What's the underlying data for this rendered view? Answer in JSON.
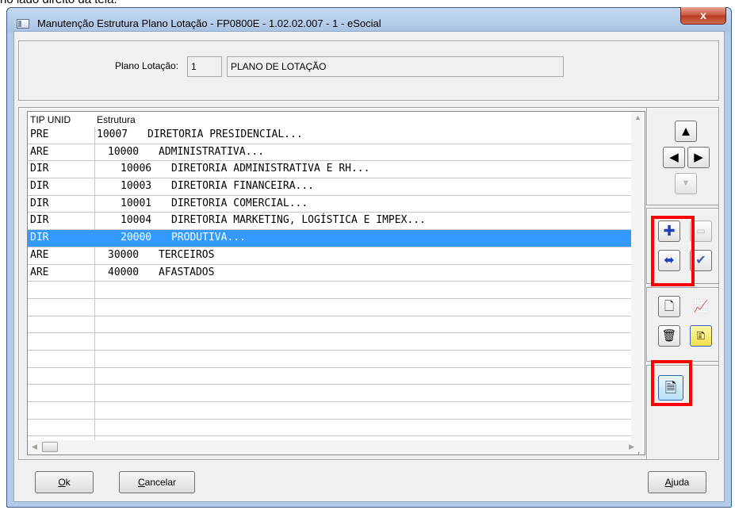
{
  "caption": "no lado direito da tela.",
  "window": {
    "title": "Manutenção Estrutura Plano Lotação - FP0800E - 1.02.02.007 - 1 - eSocial",
    "close_label": "x"
  },
  "plano": {
    "label": "Plano Lotação:",
    "code": "1",
    "name": "PLANO DE LOTAÇÃO"
  },
  "grid": {
    "columns": [
      "TIP UNID",
      "Estrutura"
    ],
    "rows": [
      {
        "tip": "PRE",
        "code": "10007",
        "desc": "DIRETORIA PRESIDENCIAL...",
        "level": 0,
        "selected": false
      },
      {
        "tip": "ARE",
        "code": "10000",
        "desc": "ADMINISTRATIVA...",
        "level": 1,
        "selected": false
      },
      {
        "tip": "DIR",
        "code": "10006",
        "desc": "DIRETORIA ADMINISTRATIVA E RH...",
        "level": 2,
        "selected": false
      },
      {
        "tip": "DIR",
        "code": "10003",
        "desc": "DIRETORIA FINANCEIRA...",
        "level": 2,
        "selected": false
      },
      {
        "tip": "DIR",
        "code": "10001",
        "desc": "DIRETORIA COMERCIAL...",
        "level": 2,
        "selected": false
      },
      {
        "tip": "DIR",
        "code": "10004",
        "desc": "DIRETORIA MARKETING, LOGÍSTICA E IMPEX...",
        "level": 2,
        "selected": false
      },
      {
        "tip": "DIR",
        "code": "20000",
        "desc": "PRODUTIVA...",
        "level": 2,
        "selected": true
      },
      {
        "tip": "ARE",
        "code": "30000",
        "desc": "TERCEIROS",
        "level": 1,
        "selected": false
      },
      {
        "tip": "ARE",
        "code": "40000",
        "desc": "AFASTADOS",
        "level": 1,
        "selected": false
      },
      {
        "tip": "",
        "code": "",
        "desc": "",
        "level": 0,
        "selected": false
      },
      {
        "tip": "",
        "code": "",
        "desc": "",
        "level": 0,
        "selected": false
      },
      {
        "tip": "",
        "code": "",
        "desc": "",
        "level": 0,
        "selected": false
      },
      {
        "tip": "",
        "code": "",
        "desc": "",
        "level": 0,
        "selected": false
      },
      {
        "tip": "",
        "code": "",
        "desc": "",
        "level": 0,
        "selected": false
      },
      {
        "tip": "",
        "code": "",
        "desc": "",
        "level": 0,
        "selected": false
      },
      {
        "tip": "",
        "code": "",
        "desc": "",
        "level": 0,
        "selected": false
      },
      {
        "tip": "",
        "code": "",
        "desc": "",
        "level": 0,
        "selected": false
      },
      {
        "tip": "",
        "code": "",
        "desc": "",
        "level": 0,
        "selected": false
      },
      {
        "tip": "",
        "code": "",
        "desc": "",
        "level": 0,
        "selected": false
      },
      {
        "tip": "",
        "code": "",
        "desc": "",
        "level": 0,
        "selected": false
      }
    ]
  },
  "icons": {
    "up": "▲",
    "left": "◀",
    "right": "▶",
    "down": "▼",
    "add": "✚",
    "add_sub": "⬌",
    "remove": "▭",
    "check": "✔",
    "new_doc": "🗋",
    "chart": "📈",
    "trash": "🗑",
    "note": "🗈",
    "page": "🗎"
  },
  "buttons": {
    "ok_u": "O",
    "ok_rest": "k",
    "cancel_u": "C",
    "cancel_rest": "ancelar",
    "help_u": "A",
    "help_rest": "juda"
  }
}
